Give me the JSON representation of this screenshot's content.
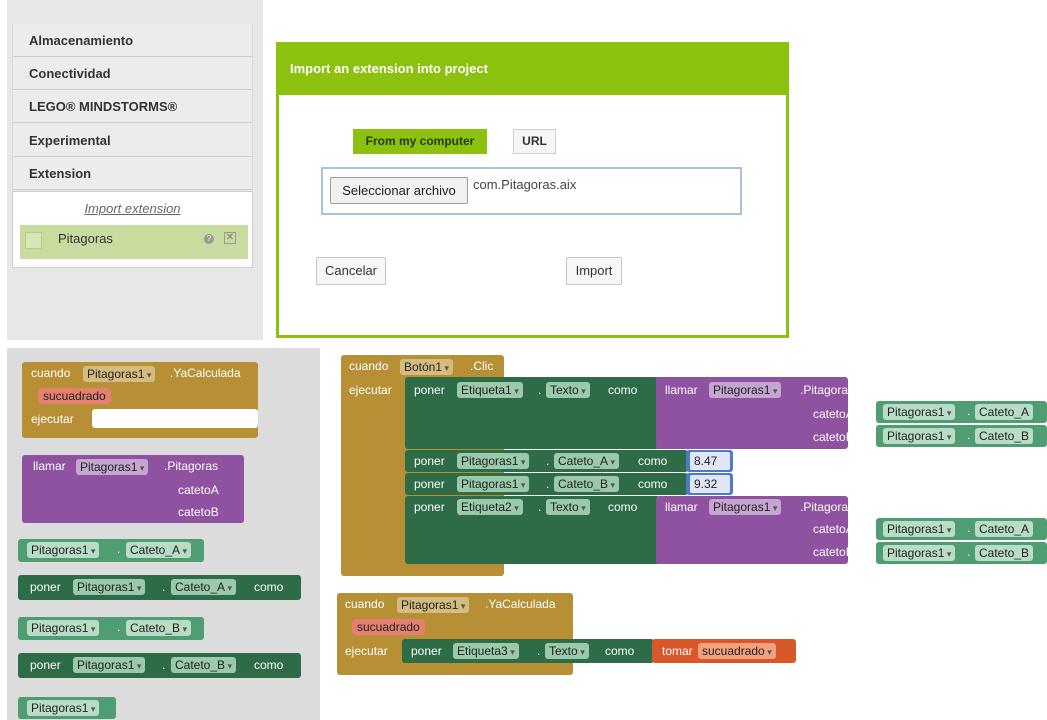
{
  "palette": {
    "categories": [
      "Almacenamiento",
      "Conectividad",
      "LEGO® MINDSTORMS®",
      "Experimental",
      "Extension"
    ],
    "import_link": "Import extension",
    "extension_item": "Pitagoras",
    "help_glyph": "?",
    "delete_glyph": "✕"
  },
  "dialog": {
    "title": "Import an extension into project",
    "tab_computer": "From my computer",
    "tab_url": "URL",
    "file_button": "Seleccionar archivo",
    "file_name": "com.Pitagoras.aix",
    "cancel": "Cancelar",
    "import": "Import"
  },
  "blocks": {
    "cuando": "cuando",
    "ejecutar": "ejecutar",
    "llamar": "llamar",
    "poner": "poner",
    "como": "como",
    "tomar": "tomar",
    "dot": ".",
    "pitagoras1": "Pitagoras1",
    "yacalculada": ".YaCalculada",
    "pitagoras_method": ".Pitagoras",
    "sucuadrado": "sucuadrado",
    "catetoA": "catetoA",
    "catetoB": "catetoB",
    "cateto_a": "Cateto_A",
    "cateto_b": "Cateto_B",
    "boton1": "Botón1",
    "clic": ".Clic",
    "etiqueta1": "Etiqueta1",
    "etiqueta2": "Etiqueta2",
    "etiqueta3": "Etiqueta3",
    "texto": "Texto",
    "val_a": "8.47",
    "val_b": "9.32"
  },
  "colors": {
    "dialog_accent": "#8cc20f",
    "event_block": "#b78f35",
    "method_block": "#8e52a1",
    "setter_block": "#2d6c47",
    "getter_block": "#4f9d73",
    "local_var_block": "#d9582a",
    "number_block": "#4f7bc6"
  }
}
